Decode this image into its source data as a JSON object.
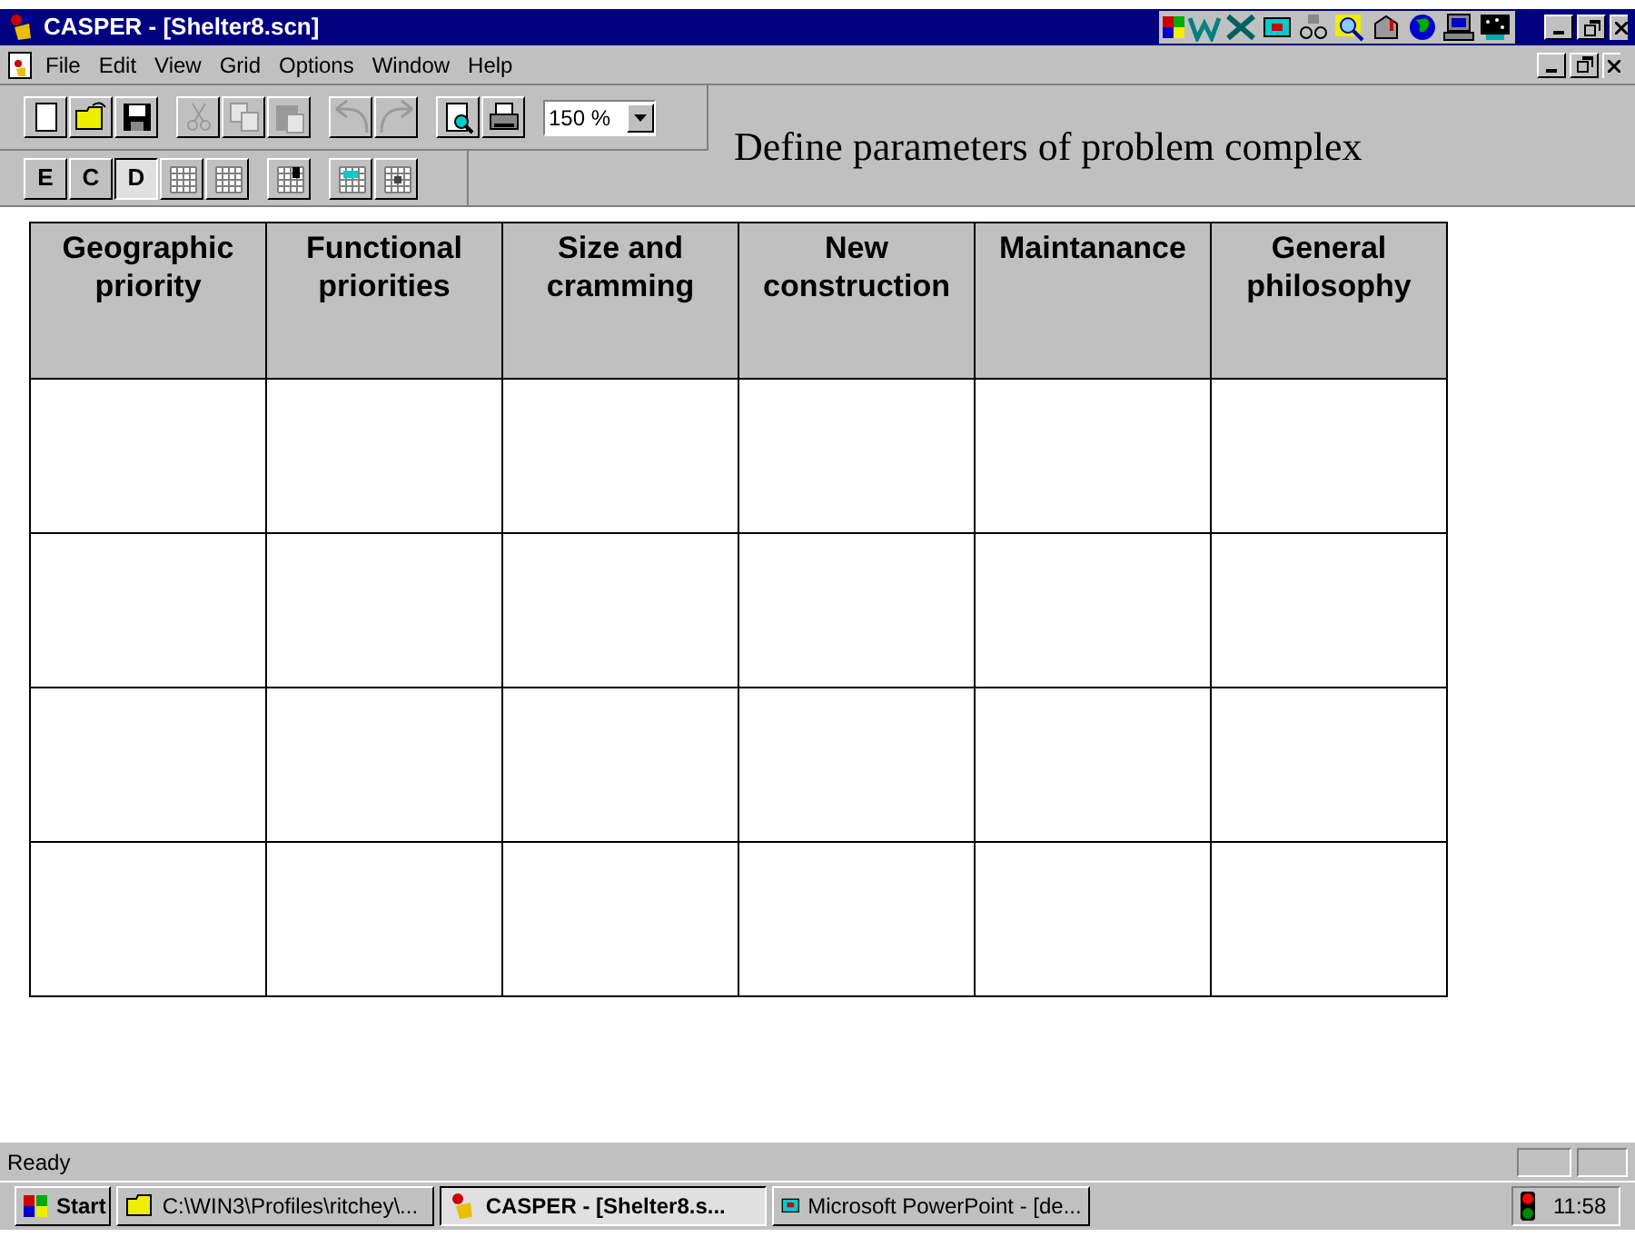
{
  "window": {
    "title": "CASPER - [Shelter8.scn]"
  },
  "menu": [
    "File",
    "Edit",
    "View",
    "Grid",
    "Options",
    "Window",
    "Help"
  ],
  "toolbar": [
    {
      "kind": "new",
      "disabled": false
    },
    {
      "kind": "open",
      "disabled": false
    },
    {
      "kind": "save",
      "disabled": false
    },
    {
      "kind": "sep"
    },
    {
      "kind": "cut",
      "disabled": true
    },
    {
      "kind": "copy",
      "disabled": true
    },
    {
      "kind": "paste",
      "disabled": true
    },
    {
      "kind": "sep"
    },
    {
      "kind": "undo",
      "disabled": true
    },
    {
      "kind": "redo",
      "disabled": true
    },
    {
      "kind": "sep"
    },
    {
      "kind": "preview",
      "disabled": false
    },
    {
      "kind": "print",
      "disabled": false
    }
  ],
  "zoom": {
    "value": "150 %"
  },
  "modes": [
    {
      "label": "E",
      "selected": false
    },
    {
      "label": "C",
      "selected": false
    },
    {
      "label": "D",
      "selected": true
    }
  ],
  "heading": "Define parameters of problem complex",
  "table": {
    "columns": [
      "Geographic priority",
      "Functional priorities",
      "Size and cramming",
      "New construction",
      "Maintanance",
      "General philosophy"
    ],
    "rows": [
      {
        "kind": "blank"
      },
      {
        "kind": "blank"
      },
      {
        "kind": "blank"
      },
      {
        "kind": "blank"
      }
    ]
  },
  "status_bar": {
    "text": "Ready"
  },
  "taskbar": {
    "start": "Start",
    "tasks": [
      {
        "label": "C:\\WIN3\\Profiles\\ritchey\\...",
        "kind": "folder",
        "selected": false
      },
      {
        "label": "CASPER - [Shelter8.s...",
        "kind": "casper",
        "selected": true
      },
      {
        "label": "Microsoft PowerPoint - [de...",
        "kind": "slides",
        "selected": false
      }
    ],
    "clock": "11:58"
  }
}
